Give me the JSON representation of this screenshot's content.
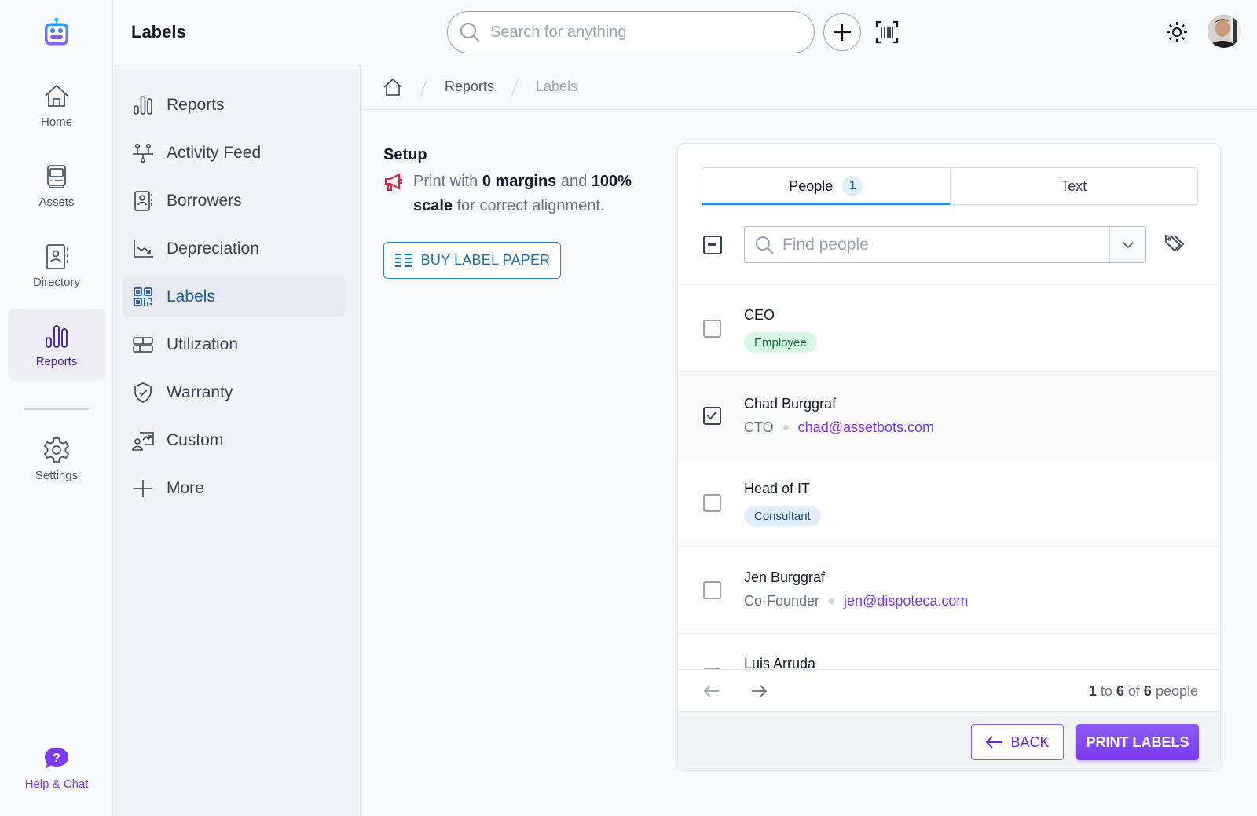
{
  "app": {
    "page_title": "Labels",
    "search_placeholder": "Search for anything"
  },
  "rail": {
    "items": [
      {
        "label": "Home",
        "icon": "home-icon"
      },
      {
        "label": "Assets",
        "icon": "computer-icon"
      },
      {
        "label": "Directory",
        "icon": "contact-book-icon"
      },
      {
        "label": "Reports",
        "icon": "bar-chart-icon",
        "active": true
      },
      {
        "label": "Settings",
        "icon": "gear-icon"
      }
    ],
    "help_label": "Help & Chat"
  },
  "subnav": {
    "items": [
      {
        "label": "Reports",
        "icon": "bar-chart-icon"
      },
      {
        "label": "Activity Feed",
        "icon": "timeline-icon"
      },
      {
        "label": "Borrowers",
        "icon": "contact-book-icon"
      },
      {
        "label": "Depreciation",
        "icon": "trend-down-icon"
      },
      {
        "label": "Labels",
        "icon": "qr-code-icon",
        "active": true
      },
      {
        "label": "Utilization",
        "icon": "table-icon"
      },
      {
        "label": "Warranty",
        "icon": "shield-check-icon"
      },
      {
        "label": "Custom",
        "icon": "presentation-icon"
      },
      {
        "label": "More",
        "icon": "plus-icon"
      }
    ]
  },
  "breadcrumb": {
    "items": [
      "Reports",
      "Labels"
    ]
  },
  "setup": {
    "title": "Setup",
    "note_parts": [
      "Print with ",
      "0 margins",
      " and ",
      "100% scale",
      " for correct alignment."
    ],
    "buy_button": "BUY LABEL PAPER"
  },
  "card": {
    "tabs": [
      {
        "label": "People",
        "badge": "1",
        "active": true
      },
      {
        "label": "Text"
      }
    ],
    "find_placeholder": "Find people",
    "people": [
      {
        "name": "CEO",
        "tag": "Employee",
        "tag_color": "green",
        "checked": false
      },
      {
        "name": "Chad Burggraf",
        "title": "CTO",
        "email": "chad@assetbots.com",
        "checked": true
      },
      {
        "name": "Head of IT",
        "tag": "Consultant",
        "tag_color": "blue",
        "checked": false
      },
      {
        "name": "Jen Burggraf",
        "title": "Co-Founder",
        "email": "jen@dispoteca.com",
        "checked": false
      },
      {
        "name": "Luis Arruda",
        "checked": false
      }
    ],
    "pager": {
      "from": "1",
      "to_word": " to ",
      "to": "6",
      "of_word": " of ",
      "total": "6",
      "suffix": " people"
    },
    "back_button": "BACK",
    "print_button": "PRINT LABELS"
  },
  "colors": {
    "brand_purple": "#7c3aed",
    "link_blue": "#1e6fb3",
    "active_tab_underline": "#2b8ad8"
  }
}
